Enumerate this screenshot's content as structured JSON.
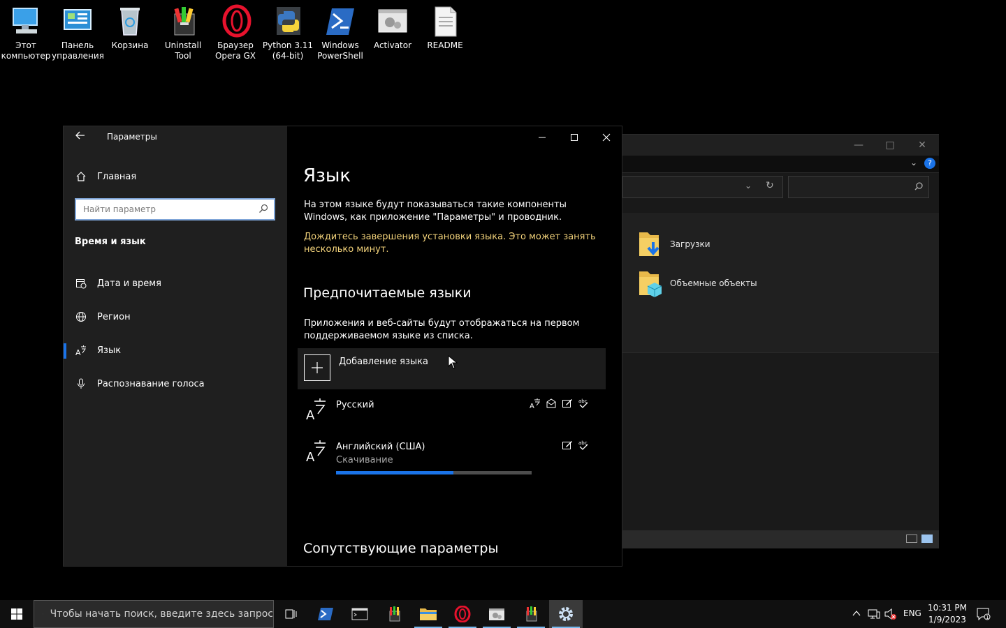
{
  "desktop": {
    "icons": [
      {
        "label": "Этот компьютер",
        "icon": "computer-icon"
      },
      {
        "label": "Панель управления",
        "icon": "control-panel-icon"
      },
      {
        "label": "Корзина",
        "icon": "recycle-bin-icon"
      },
      {
        "label": "Uninstall Tool",
        "icon": "uninstall-tool-icon"
      },
      {
        "label": "Браузер Opera GX",
        "icon": "opera-gx-icon"
      },
      {
        "label": "Python 3.11 (64-bit)",
        "icon": "python-icon"
      },
      {
        "label": "Windows PowerShell",
        "icon": "powershell-icon"
      },
      {
        "label": "Activator",
        "icon": "activator-icon"
      },
      {
        "label": "README",
        "icon": "text-file-icon"
      }
    ]
  },
  "explorer": {
    "items": [
      {
        "label": "Загрузки",
        "icon": "downloads-folder-icon"
      },
      {
        "label": "Объемные объекты",
        "icon": "3d-objects-folder-icon"
      }
    ]
  },
  "settings": {
    "window_title": "Параметры",
    "home_label": "Главная",
    "search_placeholder": "Найти параметр",
    "section": "Время и язык",
    "nav": [
      {
        "label": "Дата и время",
        "icon": "calendar-clock-icon"
      },
      {
        "label": "Регион",
        "icon": "globe-icon"
      },
      {
        "label": "Язык",
        "icon": "language-icon",
        "active": true
      },
      {
        "label": "Распознавание голоса",
        "icon": "microphone-icon"
      }
    ],
    "page_title": "Язык",
    "intro": "На этом языке будут показываться такие компоненты Windows, как приложение \"Параметры\" и проводник.",
    "warning": "Дождитесь завершения установки языка. Это может занять несколько минут.",
    "preferred_title": "Предпочитаемые языки",
    "preferred_desc": "Приложения и веб-сайты будут отображаться на первом поддерживаемом языке из списка.",
    "add_language_label": "Добавление языка",
    "languages": [
      {
        "name": "Русский",
        "status": "",
        "features": [
          "display-language-icon",
          "speech-icon",
          "handwriting-icon",
          "spellcheck-icon"
        ]
      },
      {
        "name": "Английский (США)",
        "status": "Скачивание",
        "progress": 0.6,
        "features": [
          "handwriting-icon",
          "spellcheck-icon"
        ]
      }
    ],
    "related_title": "Сопутствующие параметры"
  },
  "taskbar": {
    "search_placeholder": "Чтобы начать поиск, введите здесь запрос",
    "apps": [
      "task-view-icon",
      "powershell-icon",
      "terminal-icon",
      "uninstall-tool-icon",
      "file-explorer-icon",
      "opera-gx-icon",
      "activator-icon",
      "uninstall-tool-icon",
      "settings-gear-icon"
    ],
    "language": "ENG",
    "time": "10:31 PM",
    "date": "1/9/2023"
  },
  "colors": {
    "accent": "#1a73e8",
    "warning": "#f2d27a",
    "sidebar_bg": "#1f1f1f"
  }
}
